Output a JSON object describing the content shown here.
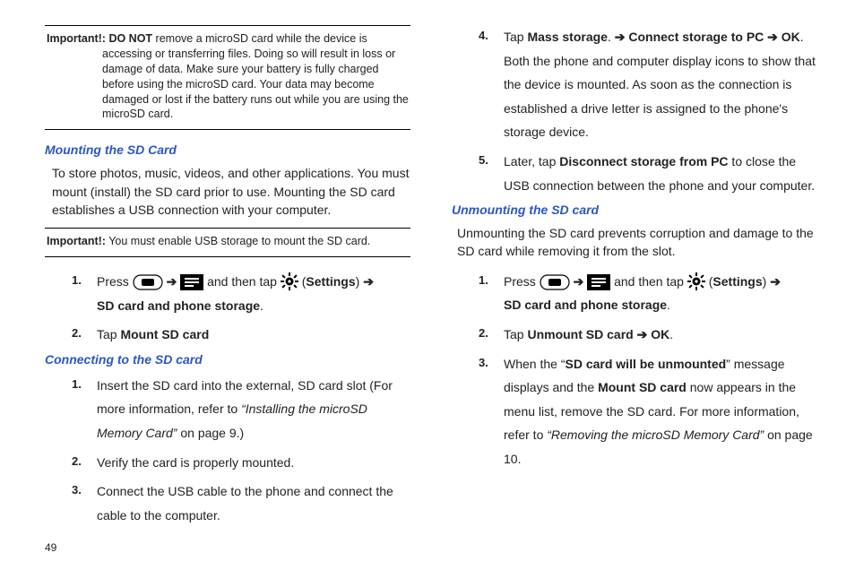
{
  "left": {
    "important1": {
      "lead": "Important!:",
      "boldPart": "DO NOT",
      "rest": " remove a microSD card while the device is accessing or transferring files. Doing so will result in loss or damage of data. Make sure your battery is fully charged before using the microSD card. Your data may become damaged or lost if the battery runs out while you are using the microSD card."
    },
    "h1": "Mounting the SD Card",
    "p1": "To store photos, music, videos, and other applications. You must mount (install) the SD card prior to use. Mounting the SD card establishes a USB connection with your computer.",
    "important2": {
      "lead": "Important!:",
      "rest": " You must enable USB storage to mount the SD card."
    },
    "steps1": {
      "s1a": "Press ",
      "s1b": " and then tap ",
      "s1c_settings": "Settings",
      "s1d": "SD card and phone storage",
      "s2a": "Tap ",
      "s2b": "Mount SD card"
    },
    "h2": "Connecting to the SD card",
    "steps2": {
      "s1a": "Insert the SD card into the external, SD card slot (For more information, refer to ",
      "s1b_ital": "“Installing the microSD Memory Card”",
      "s1c": " on page 9.)",
      "s2": "Verify the card is properly mounted.",
      "s3": "Connect the USB cable to the phone and connect the cable to the computer."
    }
  },
  "right": {
    "steps_cont": {
      "s4a": "Tap ",
      "s4b": "Mass storage",
      "s4c": ". ",
      "s4d": "Connect storage to PC",
      "s4e": "OK",
      "s4f": ". Both the phone and computer display icons to show that the device is mounted. As soon as the connection is established a drive letter is assigned to the phone's storage device.",
      "s5a": "Later, tap ",
      "s5b": "Disconnect storage from PC",
      "s5c": " to close the USB connection between the phone and your computer."
    },
    "h3": "Unmounting the SD card",
    "p2": "Unmounting the SD card prevents corruption and damage to the SD card while removing it from the slot.",
    "steps3": {
      "s1a": "Press ",
      "s1b": " and then tap ",
      "s1c_settings": "Settings",
      "s1d": "SD card and phone storage",
      "s2a": "Tap ",
      "s2b": "Unmount SD card",
      "s2c": "OK",
      "s3a": "When the “",
      "s3b": "SD card will be unmounted",
      "s3c": "” message displays and the ",
      "s3d": "Mount SD card",
      "s3e": " now appears in the menu list, remove the SD card. For more information, refer to ",
      "s3f_ital": "“Removing the microSD Memory Card”",
      "s3g": "  on page 10."
    }
  },
  "page": "49"
}
